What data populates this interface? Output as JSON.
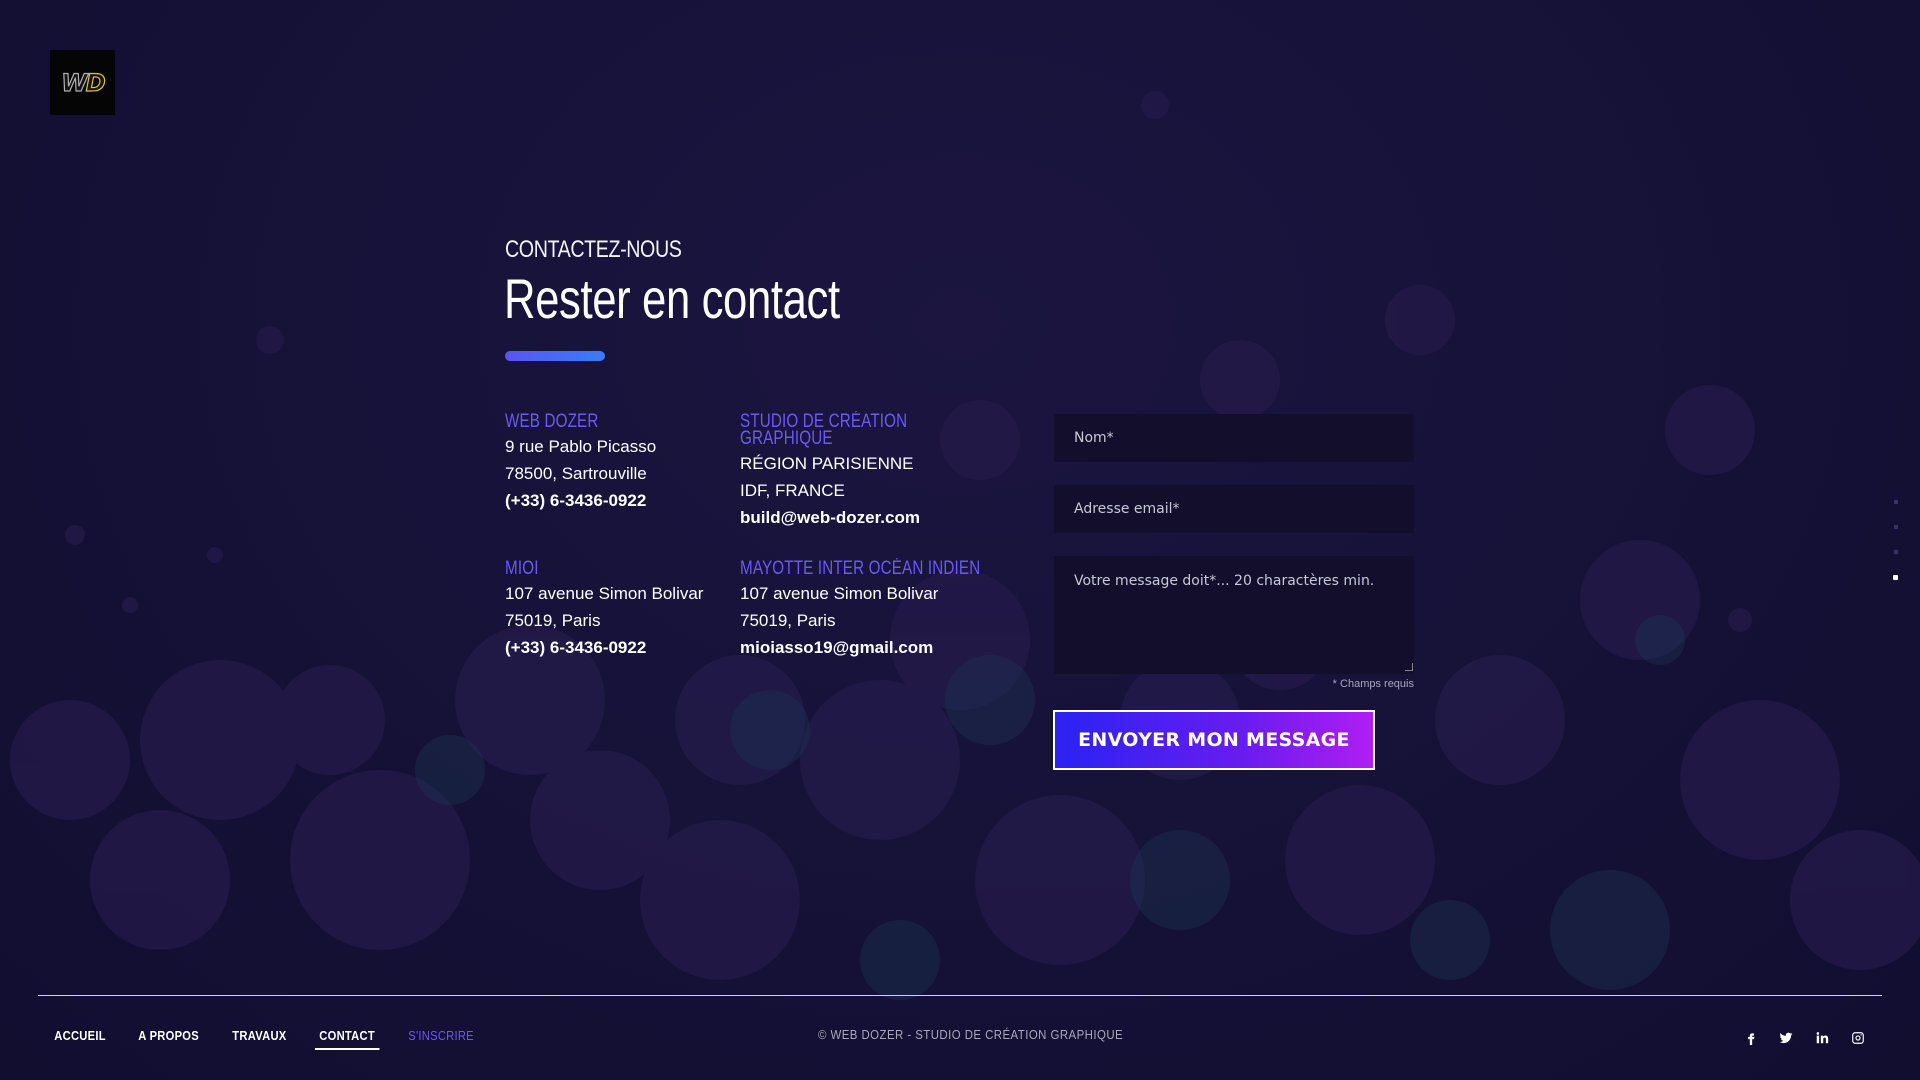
{
  "logo": {
    "text_w": "W",
    "text_d": "D"
  },
  "header": {
    "kicker": "CONTACTEZ-NOUS",
    "title": "Rester en contact"
  },
  "contacts": [
    {
      "heading": "WEB DOZER",
      "lines": [
        "9 rue Pablo Picasso",
        "78500, Sartrouville"
      ],
      "strong": "(+33) 6-3436-0922"
    },
    {
      "heading": "STUDIO DE CRÉATION GRAPHIQUE",
      "heading_line1": "STUDIO DE CRÉATION",
      "heading_line2": "GRAPHIQUE",
      "lines": [
        "RÉGION PARISIENNE",
        "IDF, FRANCE"
      ],
      "strong": "build@web-dozer.com"
    },
    {
      "heading": "MIOI",
      "lines": [
        "107 avenue Simon Bolivar",
        "75019, Paris"
      ],
      "strong": "(+33) 6-3436-0922"
    },
    {
      "heading": "MAYOTTE INTER OCÉAN INDIEN",
      "lines": [
        "107 avenue Simon Bolivar",
        "75019, Paris"
      ],
      "strong": "mioiasso19@gmail.com"
    }
  ],
  "form": {
    "name_placeholder": "Nom*",
    "email_placeholder": "Adresse email*",
    "message_placeholder": "Votre message doit*... 20 charactères min.",
    "required_note": "* Champs requis",
    "submit_label": "ENVOYER MON MESSAGE"
  },
  "section_nav": {
    "count": 4,
    "active_index": 3
  },
  "footer": {
    "nav": [
      {
        "label": "ACCUEIL"
      },
      {
        "label": "A PROPOS"
      },
      {
        "label": "TRAVAUX"
      },
      {
        "label": "CONTACT",
        "current": true
      },
      {
        "label": "S'INSCRIRE",
        "accent": true
      }
    ],
    "copyright": "© WEB DOZER - STUDIO DE CRÉATION GRAPHIQUE",
    "social": [
      "facebook-icon",
      "twitter-icon",
      "linkedin-icon",
      "instagram-icon"
    ]
  },
  "colors": {
    "background": "#17123a",
    "accent": "#6a5af7",
    "button_gradient_start": "#2a23f2",
    "button_gradient_end": "#b01ef2"
  }
}
